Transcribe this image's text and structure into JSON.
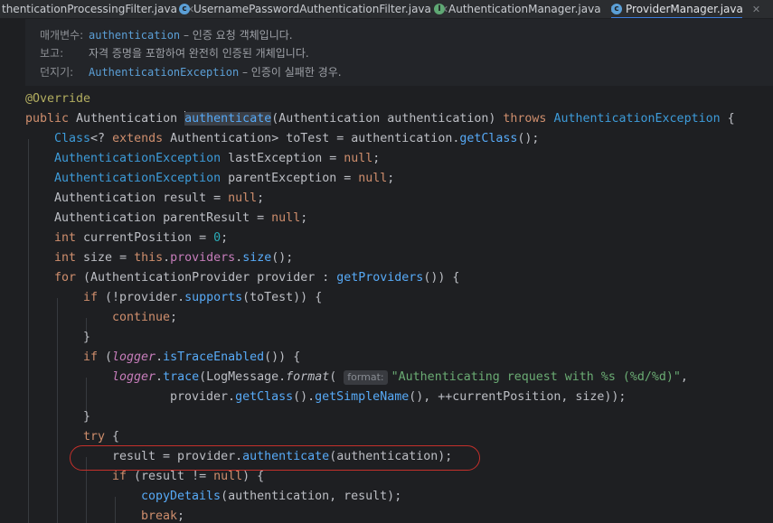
{
  "tabs": [
    {
      "label": "thenticationProcessingFilter.java",
      "icon": "none",
      "active": false
    },
    {
      "label": "UsernamePasswordAuthenticationFilter.java",
      "icon": "class-icon",
      "active": false
    },
    {
      "label": "AuthenticationManager.java",
      "icon": "interface-icon",
      "active": false
    },
    {
      "label": "ProviderManager.java",
      "icon": "class-icon",
      "active": true
    }
  ],
  "tab_close": "✕",
  "doc": {
    "params_key": "매개변수:",
    "params_name": "authentication",
    "params_text": " – 인증 요청 객체입니다.",
    "returns_key": "보고:",
    "returns_text": "자격 증명을 포함하여 완전히 인증된 개체입니다.",
    "throws_key": "던지기:",
    "throws_name": "AuthenticationException",
    "throws_text": " – 인증이 실패한 경우."
  },
  "code": {
    "annotation": "@Override",
    "hint_format": "format:",
    "trace_string": "\"Authenticating request with %s (%d/%d)\"",
    "current_position_init": "0"
  },
  "colors": {
    "highlight_ellipse": "#c4302b",
    "active_tab_underline": "#3d7ee0"
  }
}
